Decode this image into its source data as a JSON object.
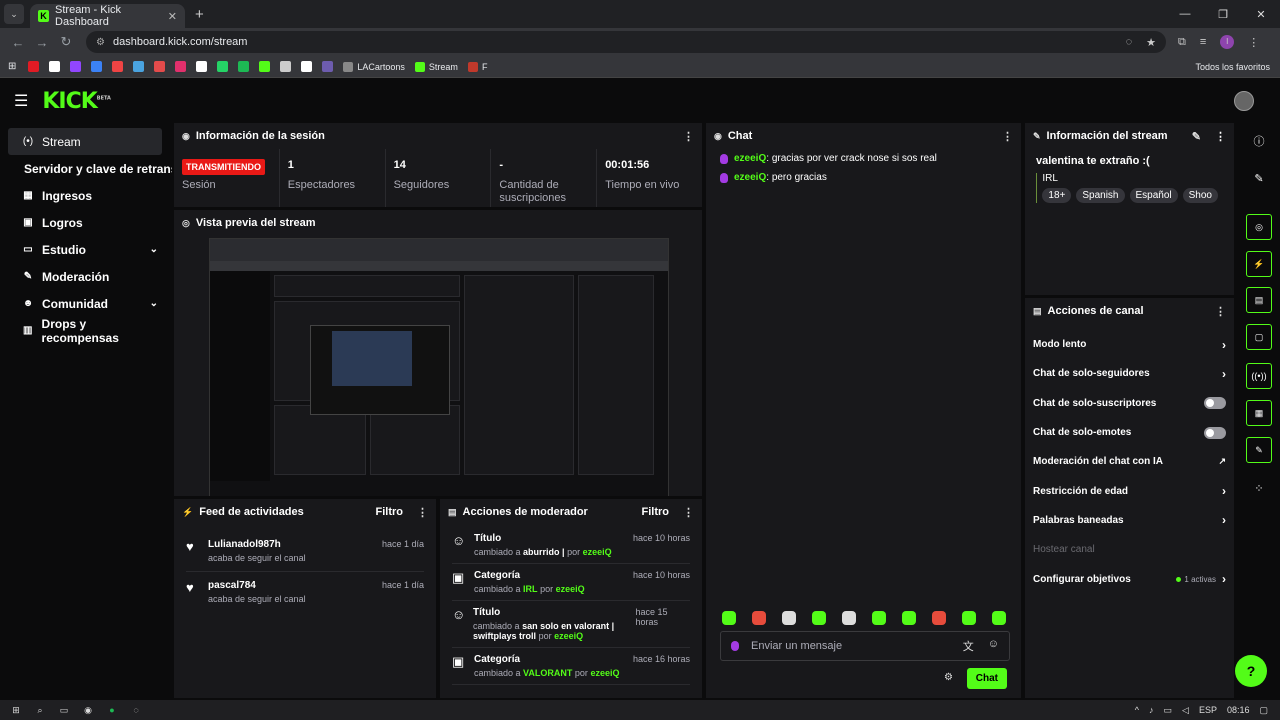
{
  "browser": {
    "tab_title": "Stream - Kick Dashboard",
    "url": "dashboard.kick.com/stream",
    "bookmarks": [
      {
        "label": "LACartoons",
        "color": "#888"
      },
      {
        "label": "Stream",
        "color": "#53fc18"
      },
      {
        "label": "F",
        "color": "#c0392b"
      }
    ],
    "favorites_label": "Todos los favoritos",
    "bookmark_icons": [
      "#e01b24",
      "#ffffff",
      "#9146ff",
      "#3b82f6",
      "#ef4444",
      "#4aa3df",
      "#e34b4b",
      "#e1306c",
      "#ffffff",
      "#25d366",
      "#1db954",
      "#53fc18",
      "#cccccc",
      "#ffffff",
      "#6d5cae"
    ]
  },
  "app": {
    "logo": "KICK",
    "beta": "BETA"
  },
  "sidebar": {
    "items": [
      {
        "label": "Stream",
        "icon": "(•)"
      },
      {
        "label": "Servidor y clave de retransmisión"
      },
      {
        "label": "Ingresos",
        "icon": "▦"
      },
      {
        "label": "Logros",
        "icon": "▣"
      },
      {
        "label": "Estudio",
        "icon": "▭"
      },
      {
        "label": "Moderación",
        "icon": "✎"
      },
      {
        "label": "Comunidad",
        "icon": "☻"
      },
      {
        "label": "Drops y recompensas",
        "icon": "▥"
      }
    ]
  },
  "session": {
    "title": "Información de la sesión",
    "status": "TRANSMITIENDO",
    "status_label": "Sesión",
    "viewers": "1",
    "viewers_label": "Espectadores",
    "followers": "14",
    "followers_label": "Seguidores",
    "subs": "-",
    "subs_label": "Cantidad de suscripciones",
    "time": "00:01:56",
    "time_label": "Tiempo en vivo"
  },
  "preview": {
    "title": "Vista previa del stream"
  },
  "activity": {
    "title": "Feed de actividades",
    "filter": "Filtro",
    "items": [
      {
        "user": "Lulianadol987h",
        "text": "acaba de seguir el canal",
        "time": "hace 1 día"
      },
      {
        "user": "pascal784",
        "text": "acaba de seguir el canal",
        "time": "hace 1 día"
      }
    ]
  },
  "modactions": {
    "title": "Acciones de moderador",
    "filter": "Filtro",
    "items": [
      {
        "title": "Título",
        "pre": "cambiado a",
        "val": "aburrido |",
        "by": "por",
        "mod": "ezeeiQ",
        "time": "hace 10 horas"
      },
      {
        "title": "Categoría",
        "pre": "cambiado a",
        "val": "IRL",
        "by": "por",
        "mod": "ezeeiQ",
        "time": "hace 10 horas"
      },
      {
        "title": "Título",
        "pre": "cambiado a",
        "val": "san solo en valorant | swiftplays troll",
        "by": "por",
        "mod": "ezeeiQ",
        "time": "hace 15 horas"
      },
      {
        "title": "Categoría",
        "pre": "cambiado a",
        "val": "VALORANT",
        "by": "por",
        "mod": "ezeeiQ",
        "time": "hace 16 horas"
      }
    ]
  },
  "chat": {
    "title": "Chat",
    "messages": [
      {
        "user": "ezeeiQ",
        "text": "gracias por ver crack nose si sos real"
      },
      {
        "user": "ezeeiQ",
        "text": "pero gracias"
      }
    ],
    "placeholder": "Enviar un mensaje",
    "send": "Chat"
  },
  "streaminfo": {
    "title": "Información del stream",
    "stream_title": "valentina te extraño :(",
    "category": "IRL",
    "tags": [
      "18+",
      "Spanish",
      "Español",
      "Shoo"
    ]
  },
  "channel": {
    "title": "Acciones de canal",
    "items": [
      {
        "label": "Modo lento",
        "type": "chevron"
      },
      {
        "label": "Chat de solo-seguidores",
        "type": "chevron"
      },
      {
        "label": "Chat de solo-suscriptores",
        "type": "toggle"
      },
      {
        "label": "Chat de solo-emotes",
        "type": "toggle"
      },
      {
        "label": "Moderación del chat con IA",
        "type": "ext"
      },
      {
        "label": "Restricción de edad",
        "type": "chevron"
      },
      {
        "label": "Palabras baneadas",
        "type": "chevron"
      },
      {
        "label": "Hostear canal",
        "type": "dim"
      },
      {
        "label": "Configurar objetivos",
        "type": "goals",
        "extra": "1 activas"
      }
    ]
  },
  "taskbar": {
    "lang": "ESP",
    "time": "08:16"
  }
}
